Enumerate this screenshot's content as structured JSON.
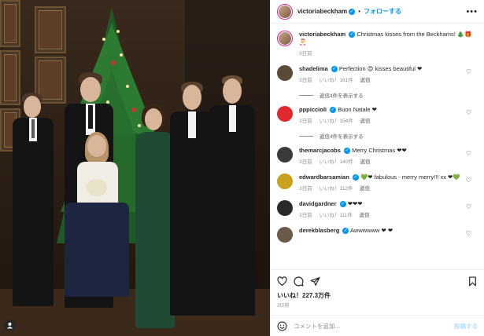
{
  "header": {
    "username": "victoriabeckham",
    "follow_label": "フォローする",
    "more_label": "•••"
  },
  "caption": {
    "username": "victoriabeckham",
    "text": "Christmas kisses from the Beckhams! 🎄🎁🎅",
    "time": "3日前"
  },
  "comments": [
    {
      "username": "shadelima",
      "text": "Perfection 😍 kisses beautiful ❤",
      "time": "3日前",
      "likes": "いいね！181件",
      "reply": "返信",
      "view_replies": "返信4件を表示する",
      "avatar_color": "#5a4a3a"
    },
    {
      "username": "pppiccioli",
      "text": "Buon Natale ❤",
      "time": "3日前",
      "likes": "いいね！154件",
      "reply": "返信",
      "view_replies": "返信4件を表示する",
      "avatar_color": "#e0282e"
    },
    {
      "username": "themarcjacobs",
      "text": "Merry Christmas ❤❤",
      "time": "3日前",
      "likes": "いいね！140件",
      "reply": "返信",
      "view_replies": "",
      "avatar_color": "#3a3a3a"
    },
    {
      "username": "edwardbarsamian",
      "text": "💚❤ fabulous - merry merry!!! xx ❤💚",
      "time": "3日前",
      "likes": "いいね！112件",
      "reply": "返信",
      "view_replies": "",
      "avatar_color": "#c9a020"
    },
    {
      "username": "davidgardner",
      "text": "❤❤❤",
      "time": "3日前",
      "likes": "いいね！111件",
      "reply": "返信",
      "view_replies": "",
      "avatar_color": "#2a2a2a"
    },
    {
      "username": "derekblasberg",
      "text": "Awwwwww ❤ ❤",
      "time": "",
      "likes": "",
      "reply": "",
      "view_replies": "",
      "avatar_color": "#6a5a4a"
    }
  ],
  "actions": {
    "likes": "いいね！227.3万件",
    "posted": "3日前"
  },
  "comment_box": {
    "placeholder": "コメントを追加...",
    "post_label": "投稿する"
  },
  "colors": {
    "accent": "#0095f6",
    "verified": "#0095f6",
    "muted": "#8e8e8e"
  }
}
